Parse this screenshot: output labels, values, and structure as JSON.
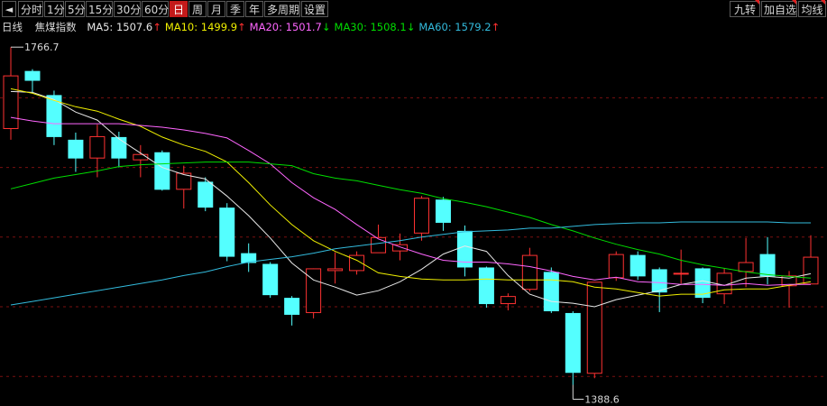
{
  "toolbar": {
    "arrow": "◄",
    "tabs": [
      "分时",
      "1分",
      "5分",
      "15分",
      "30分",
      "60分",
      "日",
      "周",
      "月",
      "季",
      "年",
      "多周期",
      "设置"
    ],
    "active_index": 6,
    "right_buttons": [
      "九转",
      "加自选",
      "均线"
    ]
  },
  "info": {
    "period": "日线",
    "name": "焦煤指数",
    "indicators": [
      {
        "label": "MA5: 1507.6",
        "arrow": "↑",
        "color": "#e8e8e8",
        "arrow_color": "#ff3030"
      },
      {
        "label": "MA10: 1499.9",
        "arrow": "↑",
        "color": "#f0f000",
        "arrow_color": "#ff3030"
      },
      {
        "label": "MA20: 1501.7",
        "arrow": "↓",
        "color": "#ff66ff",
        "arrow_color": "#00e000"
      },
      {
        "label": "MA30: 1508.1",
        "arrow": "↓",
        "color": "#00dd00",
        "arrow_color": "#00e000"
      },
      {
        "label": "MA60: 1579.2",
        "arrow": "↑",
        "color": "#33bbdd",
        "arrow_color": "#ff3030"
      }
    ]
  },
  "chart_data": {
    "type": "candlestick",
    "ylim": [
      1375,
      1775
    ],
    "gridlines": [
      1710,
      1632,
      1554,
      1476,
      1398
    ],
    "max_label": "1766.7",
    "min_label": "1388.6",
    "max_value": 1766.7,
    "min_value": 1388.6,
    "max_index": 0,
    "min_index": 26,
    "up_color": "#ff3232",
    "down_color": "#54ffff",
    "candles": [
      [
        1675,
        1735,
        1663,
        1766.7
      ],
      [
        1740,
        1729,
        1716,
        1742
      ],
      [
        1713,
        1666,
        1657,
        1718
      ],
      [
        1663,
        1642,
        1627,
        1671
      ],
      [
        1642,
        1667,
        1621,
        1680
      ],
      [
        1666,
        1642,
        1632,
        1672
      ],
      [
        1640,
        1647,
        1621,
        1657
      ],
      [
        1649,
        1607,
        1606,
        1651
      ],
      [
        1607,
        1626,
        1586,
        1634
      ],
      [
        1616,
        1587,
        1583,
        1621
      ],
      [
        1587,
        1532,
        1527,
        1592
      ],
      [
        1536,
        1525,
        1515,
        1547
      ],
      [
        1524,
        1489,
        1486,
        1526
      ],
      [
        1486,
        1467,
        1455,
        1488
      ],
      [
        1469,
        1519,
        1463,
        1519
      ],
      [
        1516,
        1519,
        1502,
        1537
      ],
      [
        1516,
        1534,
        1512,
        1538
      ],
      [
        1536,
        1554,
        1537,
        1568
      ],
      [
        1538,
        1546,
        1528,
        1558
      ],
      [
        1558,
        1598,
        1550,
        1600
      ],
      [
        1596,
        1570,
        1561,
        1599
      ],
      [
        1561,
        1520,
        1510,
        1567
      ],
      [
        1520,
        1479,
        1475,
        1521
      ],
      [
        1479,
        1488,
        1472,
        1491
      ],
      [
        1495,
        1534,
        1493,
        1542
      ],
      [
        1515,
        1471,
        1469,
        1520
      ],
      [
        1469,
        1402,
        1388.6,
        1471
      ],
      [
        1401,
        1504,
        1396,
        1503
      ],
      [
        1508,
        1535,
        1505,
        1538
      ],
      [
        1534,
        1510,
        1506,
        1538
      ],
      [
        1518,
        1492,
        1470,
        1520
      ],
      [
        1513,
        1514,
        1502,
        1540
      ],
      [
        1519,
        1486,
        1480,
        1520
      ],
      [
        1490,
        1514,
        1479,
        1519
      ],
      [
        1515,
        1526,
        1498,
        1553
      ],
      [
        1535,
        1510,
        1501,
        1554
      ],
      [
        1499,
        1511,
        1475,
        1516
      ],
      [
        1501,
        1532,
        1502,
        1556
      ]
    ],
    "ma": [
      {
        "key": "MA5",
        "color": "#e8e8e8",
        "values": [
          1717,
          1716,
          1708,
          1694,
          1685,
          1664,
          1648,
          1632,
          1624,
          1619,
          1600,
          1578,
          1553,
          1525,
          1506,
          1498,
          1489,
          1494,
          1504,
          1518,
          1535,
          1544,
          1538,
          1511,
          1490,
          1482,
          1480,
          1476,
          1484,
          1489,
          1494,
          1501,
          1505,
          1500,
          1508,
          1510,
          1508,
          1513
        ]
      },
      {
        "key": "MA10",
        "color": "#f0f000",
        "values": [
          1720,
          1715,
          1707,
          1700,
          1695,
          1686,
          1678,
          1666,
          1657,
          1650,
          1638,
          1615,
          1590,
          1568,
          1550,
          1538,
          1528,
          1514,
          1510,
          1507,
          1506,
          1506,
          1507,
          1506,
          1506,
          1506,
          1504,
          1498,
          1496,
          1492,
          1488,
          1490,
          1490,
          1495,
          1496,
          1496,
          1500,
          1504
        ]
      },
      {
        "key": "MA20",
        "color": "#ff66ff",
        "values": [
          1688,
          1684,
          1681,
          1681,
          1681,
          1681,
          1679,
          1677,
          1674,
          1670,
          1665,
          1651,
          1636,
          1615,
          1598,
          1585,
          1568,
          1552,
          1543,
          1535,
          1528,
          1526,
          1526,
          1524,
          1521,
          1516,
          1510,
          1506,
          1509,
          1504,
          1503,
          1501,
          1501,
          1500,
          1502,
          1500,
          1501,
          1501
        ]
      },
      {
        "key": "MA30",
        "color": "#00dd00",
        "values": [
          1608,
          1614,
          1620,
          1624,
          1628,
          1633,
          1635,
          1636,
          1637,
          1638,
          1638,
          1638,
          1636,
          1634,
          1625,
          1620,
          1617,
          1612,
          1607,
          1603,
          1597,
          1593,
          1588,
          1582,
          1576,
          1568,
          1561,
          1553,
          1546,
          1540,
          1535,
          1528,
          1523,
          1519,
          1515,
          1512,
          1510,
          1508
        ]
      },
      {
        "key": "MA60",
        "color": "#33bbdd",
        "values": [
          1478,
          1482,
          1486,
          1490,
          1494,
          1498,
          1502,
          1506,
          1511,
          1515,
          1521,
          1526,
          1529,
          1532,
          1536,
          1541,
          1544,
          1547,
          1550,
          1554,
          1557,
          1560,
          1561,
          1562,
          1564,
          1564,
          1566,
          1568,
          1569,
          1570,
          1570,
          1571,
          1571,
          1571,
          1571,
          1571,
          1570,
          1570
        ]
      }
    ]
  }
}
